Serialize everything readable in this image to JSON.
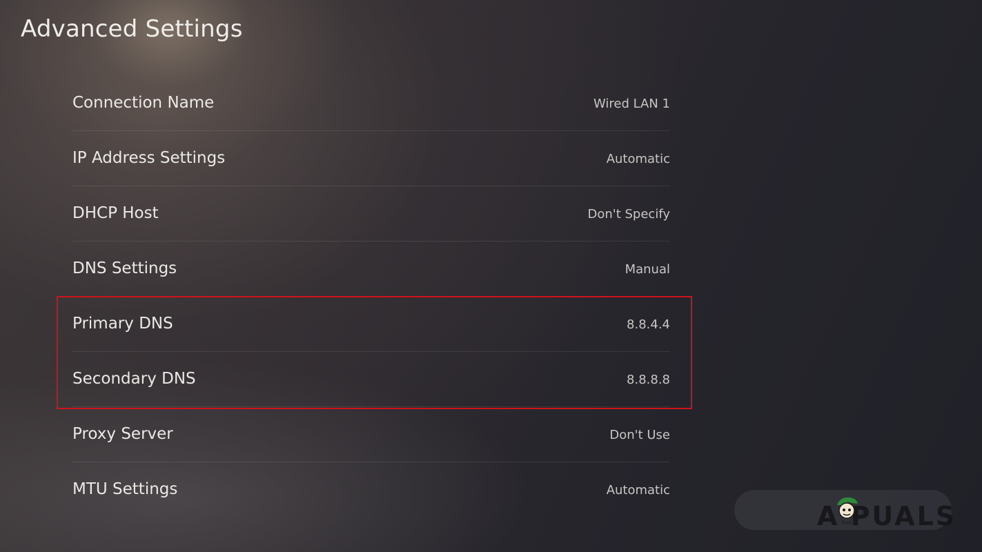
{
  "page": {
    "title": "Advanced Settings"
  },
  "settings": [
    {
      "label": "Connection Name",
      "value": "Wired LAN 1"
    },
    {
      "label": "IP Address Settings",
      "value": "Automatic"
    },
    {
      "label": "DHCP Host",
      "value": "Don't Specify"
    },
    {
      "label": "DNS Settings",
      "value": "Manual"
    },
    {
      "label": "Primary DNS",
      "value": "8.8.4.4"
    },
    {
      "label": "Secondary DNS",
      "value": "8.8.8.8"
    },
    {
      "label": "Proxy Server",
      "value": "Don't Use"
    },
    {
      "label": "MTU Settings",
      "value": "Automatic"
    }
  ],
  "annotation": {
    "highlight_color": "#d0121b",
    "highlighted_rows": [
      "Primary DNS",
      "Secondary DNS"
    ]
  },
  "watermark": {
    "text": "A  PUALS",
    "logo": "appuals-mascot"
  }
}
